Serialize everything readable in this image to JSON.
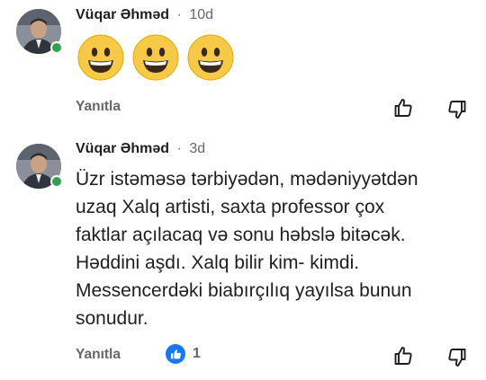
{
  "comments": [
    {
      "author": "Vüqar Əhməd",
      "separator": "·",
      "time": "10d",
      "emojis": [
        "grinning-face",
        "grinning-face",
        "grinning-face"
      ],
      "reply_label": "Yanıtla"
    },
    {
      "author": "Vüqar Əhməd",
      "separator": "·",
      "time": "3d",
      "lines": [
        "Üzr istəməsə tərbiyədən, mədəniyyətdən",
        "uzaq Xalq artisti, saxta professor çox",
        "faktlar açılacaq və sonu həbslə bitəcək.",
        "Həddini aşdı. Xalq bilir kim- kimdi.",
        "Messencerdəki biabırçılıq yayılsa bunun",
        "sonudur."
      ],
      "reply_label": "Yanıtla",
      "reaction": {
        "icon": "like-icon",
        "count": "1"
      }
    }
  ],
  "colors": {
    "online": "#31a24c",
    "like_badge": "#1877f2",
    "emoji_face": "#f7c948",
    "secondary_text": "#65676b"
  }
}
